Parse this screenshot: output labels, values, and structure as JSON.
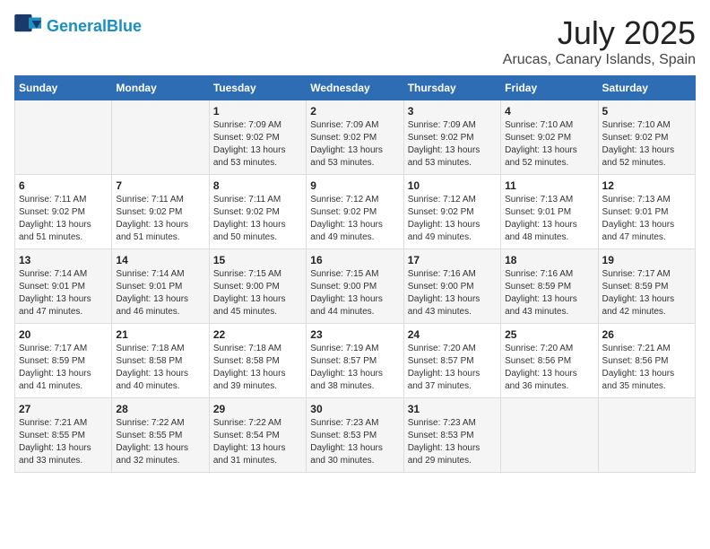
{
  "logo": {
    "line1": "General",
    "line2": "Blue"
  },
  "title": "July 2025",
  "subtitle": "Arucas, Canary Islands, Spain",
  "headers": [
    "Sunday",
    "Monday",
    "Tuesday",
    "Wednesday",
    "Thursday",
    "Friday",
    "Saturday"
  ],
  "weeks": [
    [
      {
        "day": "",
        "info": ""
      },
      {
        "day": "",
        "info": ""
      },
      {
        "day": "1",
        "info": "Sunrise: 7:09 AM\nSunset: 9:02 PM\nDaylight: 13 hours and 53 minutes."
      },
      {
        "day": "2",
        "info": "Sunrise: 7:09 AM\nSunset: 9:02 PM\nDaylight: 13 hours and 53 minutes."
      },
      {
        "day": "3",
        "info": "Sunrise: 7:09 AM\nSunset: 9:02 PM\nDaylight: 13 hours and 53 minutes."
      },
      {
        "day": "4",
        "info": "Sunrise: 7:10 AM\nSunset: 9:02 PM\nDaylight: 13 hours and 52 minutes."
      },
      {
        "day": "5",
        "info": "Sunrise: 7:10 AM\nSunset: 9:02 PM\nDaylight: 13 hours and 52 minutes."
      }
    ],
    [
      {
        "day": "6",
        "info": "Sunrise: 7:11 AM\nSunset: 9:02 PM\nDaylight: 13 hours and 51 minutes."
      },
      {
        "day": "7",
        "info": "Sunrise: 7:11 AM\nSunset: 9:02 PM\nDaylight: 13 hours and 51 minutes."
      },
      {
        "day": "8",
        "info": "Sunrise: 7:11 AM\nSunset: 9:02 PM\nDaylight: 13 hours and 50 minutes."
      },
      {
        "day": "9",
        "info": "Sunrise: 7:12 AM\nSunset: 9:02 PM\nDaylight: 13 hours and 49 minutes."
      },
      {
        "day": "10",
        "info": "Sunrise: 7:12 AM\nSunset: 9:02 PM\nDaylight: 13 hours and 49 minutes."
      },
      {
        "day": "11",
        "info": "Sunrise: 7:13 AM\nSunset: 9:01 PM\nDaylight: 13 hours and 48 minutes."
      },
      {
        "day": "12",
        "info": "Sunrise: 7:13 AM\nSunset: 9:01 PM\nDaylight: 13 hours and 47 minutes."
      }
    ],
    [
      {
        "day": "13",
        "info": "Sunrise: 7:14 AM\nSunset: 9:01 PM\nDaylight: 13 hours and 47 minutes."
      },
      {
        "day": "14",
        "info": "Sunrise: 7:14 AM\nSunset: 9:01 PM\nDaylight: 13 hours and 46 minutes."
      },
      {
        "day": "15",
        "info": "Sunrise: 7:15 AM\nSunset: 9:00 PM\nDaylight: 13 hours and 45 minutes."
      },
      {
        "day": "16",
        "info": "Sunrise: 7:15 AM\nSunset: 9:00 PM\nDaylight: 13 hours and 44 minutes."
      },
      {
        "day": "17",
        "info": "Sunrise: 7:16 AM\nSunset: 9:00 PM\nDaylight: 13 hours and 43 minutes."
      },
      {
        "day": "18",
        "info": "Sunrise: 7:16 AM\nSunset: 8:59 PM\nDaylight: 13 hours and 43 minutes."
      },
      {
        "day": "19",
        "info": "Sunrise: 7:17 AM\nSunset: 8:59 PM\nDaylight: 13 hours and 42 minutes."
      }
    ],
    [
      {
        "day": "20",
        "info": "Sunrise: 7:17 AM\nSunset: 8:59 PM\nDaylight: 13 hours and 41 minutes."
      },
      {
        "day": "21",
        "info": "Sunrise: 7:18 AM\nSunset: 8:58 PM\nDaylight: 13 hours and 40 minutes."
      },
      {
        "day": "22",
        "info": "Sunrise: 7:18 AM\nSunset: 8:58 PM\nDaylight: 13 hours and 39 minutes."
      },
      {
        "day": "23",
        "info": "Sunrise: 7:19 AM\nSunset: 8:57 PM\nDaylight: 13 hours and 38 minutes."
      },
      {
        "day": "24",
        "info": "Sunrise: 7:20 AM\nSunset: 8:57 PM\nDaylight: 13 hours and 37 minutes."
      },
      {
        "day": "25",
        "info": "Sunrise: 7:20 AM\nSunset: 8:56 PM\nDaylight: 13 hours and 36 minutes."
      },
      {
        "day": "26",
        "info": "Sunrise: 7:21 AM\nSunset: 8:56 PM\nDaylight: 13 hours and 35 minutes."
      }
    ],
    [
      {
        "day": "27",
        "info": "Sunrise: 7:21 AM\nSunset: 8:55 PM\nDaylight: 13 hours and 33 minutes."
      },
      {
        "day": "28",
        "info": "Sunrise: 7:22 AM\nSunset: 8:55 PM\nDaylight: 13 hours and 32 minutes."
      },
      {
        "day": "29",
        "info": "Sunrise: 7:22 AM\nSunset: 8:54 PM\nDaylight: 13 hours and 31 minutes."
      },
      {
        "day": "30",
        "info": "Sunrise: 7:23 AM\nSunset: 8:53 PM\nDaylight: 13 hours and 30 minutes."
      },
      {
        "day": "31",
        "info": "Sunrise: 7:23 AM\nSunset: 8:53 PM\nDaylight: 13 hours and 29 minutes."
      },
      {
        "day": "",
        "info": ""
      },
      {
        "day": "",
        "info": ""
      }
    ]
  ]
}
